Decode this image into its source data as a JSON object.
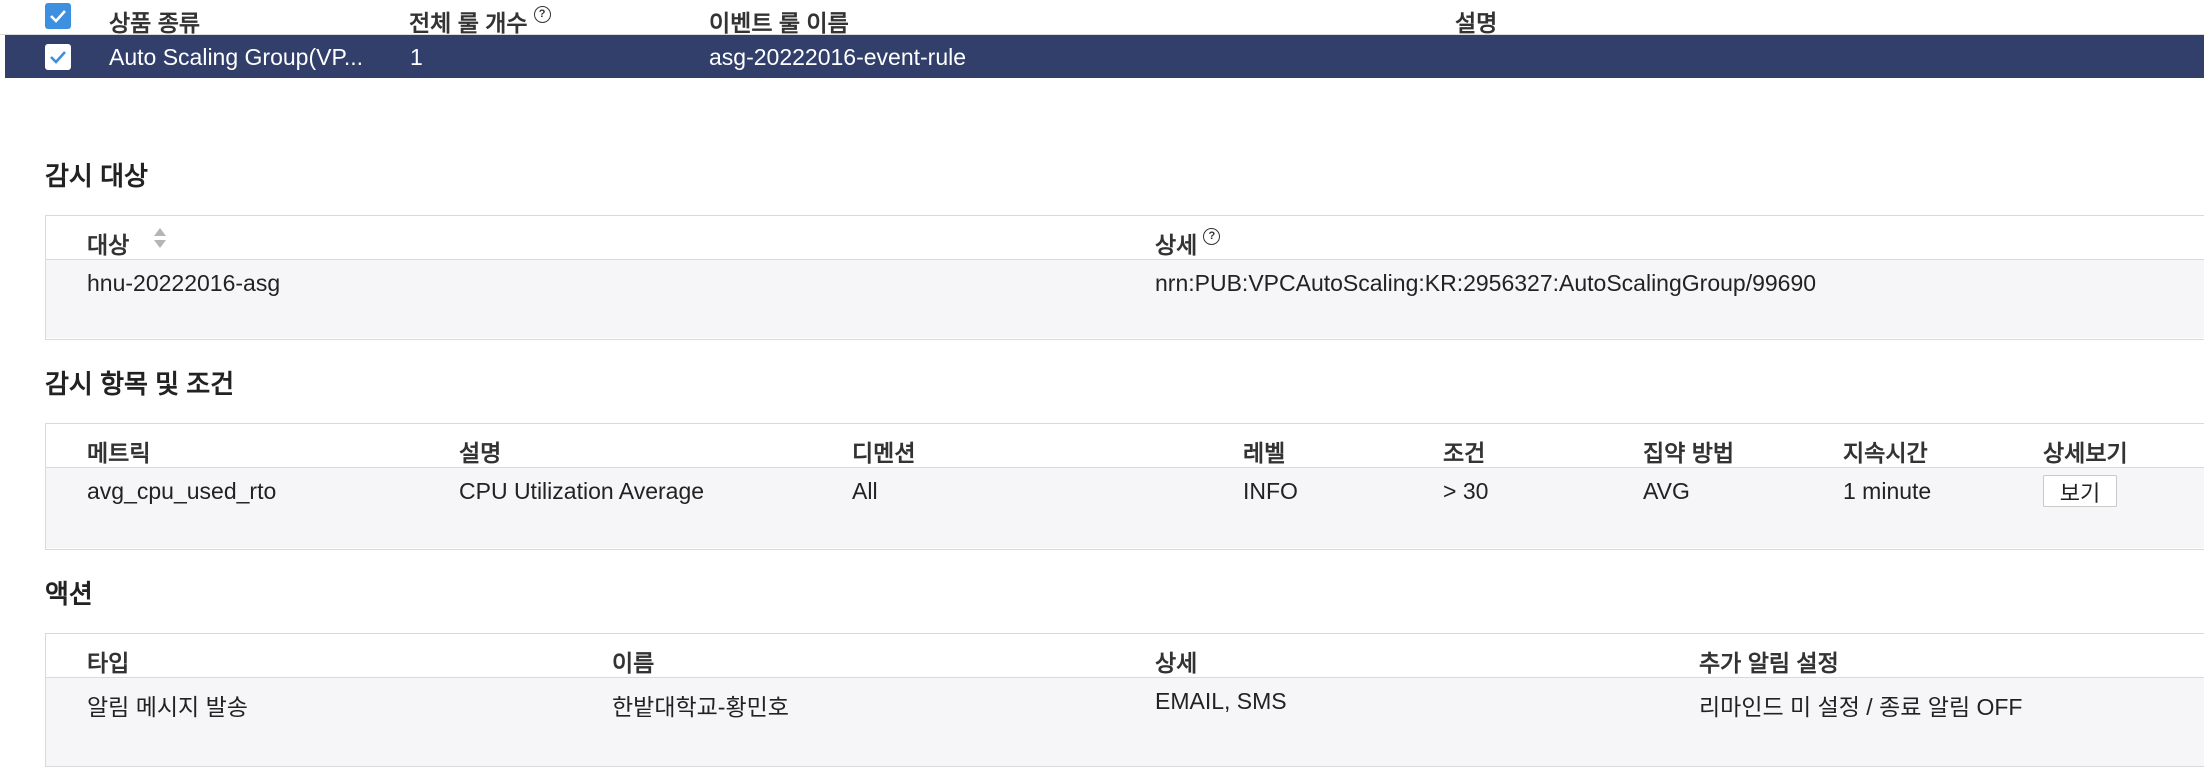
{
  "header": {
    "columns": {
      "product_type": "상품 종류",
      "total_rules": "전체 룰 개수",
      "event_rule_name": "이벤트 룰 이름",
      "description": "설명"
    }
  },
  "selected_row": {
    "product_type": "Auto Scaling Group(VP...",
    "total_rules": "1",
    "event_rule_name": "asg-20222016-event-rule",
    "description": ""
  },
  "monitoring_target": {
    "title": "감시 대상",
    "columns": {
      "target": "대상",
      "detail": "상세"
    },
    "row": {
      "target": "hnu-20222016-asg",
      "detail": "nrn:PUB:VPCAutoScaling:KR:2956327:AutoScalingGroup/99690"
    }
  },
  "monitoring_items": {
    "title": "감시 항목 및 조건",
    "columns": {
      "metric": "메트릭",
      "description": "설명",
      "dimension": "디멘션",
      "level": "레벨",
      "condition": "조건",
      "aggregation": "집약 방법",
      "duration": "지속시간",
      "details": "상세보기"
    },
    "row": {
      "metric": "avg_cpu_used_rto",
      "description": "CPU Utilization Average",
      "dimension": "All",
      "level": "INFO",
      "condition": "> 30",
      "aggregation": "AVG",
      "duration": "1 minute",
      "view_button": "보기"
    }
  },
  "actions": {
    "title": "액션",
    "columns": {
      "type": "타입",
      "name": "이름",
      "detail": "상세",
      "extra_alert": "추가 알림 설정"
    },
    "row": {
      "type": "알림 메시지 발송",
      "name": "한밭대학교-황민호",
      "detail": "EMAIL, SMS",
      "extra_alert": "리마인드 미 설정 / 종료 알림 OFF"
    }
  },
  "colors": {
    "selected_row_bg": "#323f6b",
    "checkbox_blue": "#3d8fe0",
    "table_body_bg": "#f6f6f8"
  },
  "icons": {
    "checkbox": "checkmark-icon",
    "help": "question-circle-icon",
    "sort": "sort-arrows-icon"
  }
}
